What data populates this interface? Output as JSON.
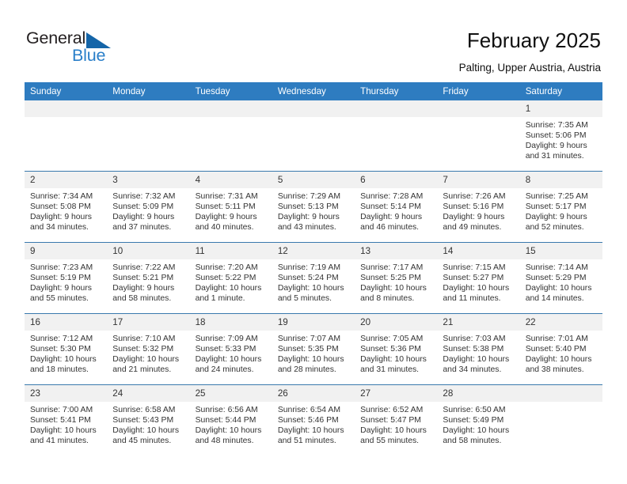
{
  "brand": {
    "name_part1": "General",
    "name_part2": "Blue",
    "triangle_color": "#1565a8",
    "blue_color": "#2a7fc9"
  },
  "header": {
    "title": "February 2025",
    "subtitle": "Palting, Upper Austria, Austria"
  },
  "theme": {
    "header_bar": "#2e7cc0",
    "daynum_band": "#f1f1f1",
    "row_separator": "#3a79ad",
    "text": "#333333"
  },
  "calendar": {
    "weekdays": [
      "Sunday",
      "Monday",
      "Tuesday",
      "Wednesday",
      "Thursday",
      "Friday",
      "Saturday"
    ],
    "labels": {
      "sunrise": "Sunrise:",
      "sunset": "Sunset:",
      "daylight": "Daylight:"
    },
    "weeks": [
      [
        {
          "day": "",
          "blank": true
        },
        {
          "day": "",
          "blank": true
        },
        {
          "day": "",
          "blank": true
        },
        {
          "day": "",
          "blank": true
        },
        {
          "day": "",
          "blank": true
        },
        {
          "day": "",
          "blank": true
        },
        {
          "day": "1",
          "sunrise": "Sunrise: 7:35 AM",
          "sunset": "Sunset: 5:06 PM",
          "daylight1": "Daylight: 9 hours",
          "daylight2": "and 31 minutes."
        }
      ],
      [
        {
          "day": "2",
          "sunrise": "Sunrise: 7:34 AM",
          "sunset": "Sunset: 5:08 PM",
          "daylight1": "Daylight: 9 hours",
          "daylight2": "and 34 minutes."
        },
        {
          "day": "3",
          "sunrise": "Sunrise: 7:32 AM",
          "sunset": "Sunset: 5:09 PM",
          "daylight1": "Daylight: 9 hours",
          "daylight2": "and 37 minutes."
        },
        {
          "day": "4",
          "sunrise": "Sunrise: 7:31 AM",
          "sunset": "Sunset: 5:11 PM",
          "daylight1": "Daylight: 9 hours",
          "daylight2": "and 40 minutes."
        },
        {
          "day": "5",
          "sunrise": "Sunrise: 7:29 AM",
          "sunset": "Sunset: 5:13 PM",
          "daylight1": "Daylight: 9 hours",
          "daylight2": "and 43 minutes."
        },
        {
          "day": "6",
          "sunrise": "Sunrise: 7:28 AM",
          "sunset": "Sunset: 5:14 PM",
          "daylight1": "Daylight: 9 hours",
          "daylight2": "and 46 minutes."
        },
        {
          "day": "7",
          "sunrise": "Sunrise: 7:26 AM",
          "sunset": "Sunset: 5:16 PM",
          "daylight1": "Daylight: 9 hours",
          "daylight2": "and 49 minutes."
        },
        {
          "day": "8",
          "sunrise": "Sunrise: 7:25 AM",
          "sunset": "Sunset: 5:17 PM",
          "daylight1": "Daylight: 9 hours",
          "daylight2": "and 52 minutes."
        }
      ],
      [
        {
          "day": "9",
          "sunrise": "Sunrise: 7:23 AM",
          "sunset": "Sunset: 5:19 PM",
          "daylight1": "Daylight: 9 hours",
          "daylight2": "and 55 minutes."
        },
        {
          "day": "10",
          "sunrise": "Sunrise: 7:22 AM",
          "sunset": "Sunset: 5:21 PM",
          "daylight1": "Daylight: 9 hours",
          "daylight2": "and 58 minutes."
        },
        {
          "day": "11",
          "sunrise": "Sunrise: 7:20 AM",
          "sunset": "Sunset: 5:22 PM",
          "daylight1": "Daylight: 10 hours",
          "daylight2": "and 1 minute."
        },
        {
          "day": "12",
          "sunrise": "Sunrise: 7:19 AM",
          "sunset": "Sunset: 5:24 PM",
          "daylight1": "Daylight: 10 hours",
          "daylight2": "and 5 minutes."
        },
        {
          "day": "13",
          "sunrise": "Sunrise: 7:17 AM",
          "sunset": "Sunset: 5:25 PM",
          "daylight1": "Daylight: 10 hours",
          "daylight2": "and 8 minutes."
        },
        {
          "day": "14",
          "sunrise": "Sunrise: 7:15 AM",
          "sunset": "Sunset: 5:27 PM",
          "daylight1": "Daylight: 10 hours",
          "daylight2": "and 11 minutes."
        },
        {
          "day": "15",
          "sunrise": "Sunrise: 7:14 AM",
          "sunset": "Sunset: 5:29 PM",
          "daylight1": "Daylight: 10 hours",
          "daylight2": "and 14 minutes."
        }
      ],
      [
        {
          "day": "16",
          "sunrise": "Sunrise: 7:12 AM",
          "sunset": "Sunset: 5:30 PM",
          "daylight1": "Daylight: 10 hours",
          "daylight2": "and 18 minutes."
        },
        {
          "day": "17",
          "sunrise": "Sunrise: 7:10 AM",
          "sunset": "Sunset: 5:32 PM",
          "daylight1": "Daylight: 10 hours",
          "daylight2": "and 21 minutes."
        },
        {
          "day": "18",
          "sunrise": "Sunrise: 7:09 AM",
          "sunset": "Sunset: 5:33 PM",
          "daylight1": "Daylight: 10 hours",
          "daylight2": "and 24 minutes."
        },
        {
          "day": "19",
          "sunrise": "Sunrise: 7:07 AM",
          "sunset": "Sunset: 5:35 PM",
          "daylight1": "Daylight: 10 hours",
          "daylight2": "and 28 minutes."
        },
        {
          "day": "20",
          "sunrise": "Sunrise: 7:05 AM",
          "sunset": "Sunset: 5:36 PM",
          "daylight1": "Daylight: 10 hours",
          "daylight2": "and 31 minutes."
        },
        {
          "day": "21",
          "sunrise": "Sunrise: 7:03 AM",
          "sunset": "Sunset: 5:38 PM",
          "daylight1": "Daylight: 10 hours",
          "daylight2": "and 34 minutes."
        },
        {
          "day": "22",
          "sunrise": "Sunrise: 7:01 AM",
          "sunset": "Sunset: 5:40 PM",
          "daylight1": "Daylight: 10 hours",
          "daylight2": "and 38 minutes."
        }
      ],
      [
        {
          "day": "23",
          "sunrise": "Sunrise: 7:00 AM",
          "sunset": "Sunset: 5:41 PM",
          "daylight1": "Daylight: 10 hours",
          "daylight2": "and 41 minutes."
        },
        {
          "day": "24",
          "sunrise": "Sunrise: 6:58 AM",
          "sunset": "Sunset: 5:43 PM",
          "daylight1": "Daylight: 10 hours",
          "daylight2": "and 45 minutes."
        },
        {
          "day": "25",
          "sunrise": "Sunrise: 6:56 AM",
          "sunset": "Sunset: 5:44 PM",
          "daylight1": "Daylight: 10 hours",
          "daylight2": "and 48 minutes."
        },
        {
          "day": "26",
          "sunrise": "Sunrise: 6:54 AM",
          "sunset": "Sunset: 5:46 PM",
          "daylight1": "Daylight: 10 hours",
          "daylight2": "and 51 minutes."
        },
        {
          "day": "27",
          "sunrise": "Sunrise: 6:52 AM",
          "sunset": "Sunset: 5:47 PM",
          "daylight1": "Daylight: 10 hours",
          "daylight2": "and 55 minutes."
        },
        {
          "day": "28",
          "sunrise": "Sunrise: 6:50 AM",
          "sunset": "Sunset: 5:49 PM",
          "daylight1": "Daylight: 10 hours",
          "daylight2": "and 58 minutes."
        },
        {
          "day": "",
          "blank": true
        }
      ]
    ]
  }
}
